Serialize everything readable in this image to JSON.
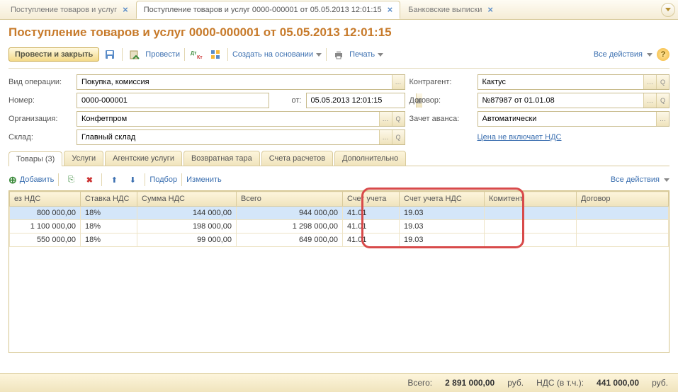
{
  "top_tabs": {
    "tab1": "Поступление товаров и услуг",
    "tab2": "Поступление товаров и услуг 0000-000001 от 05.05.2013 12:01:15",
    "tab3": "Банковские выписки"
  },
  "page_title": "Поступление товаров и услуг 0000-000001 от 05.05.2013 12:01:15",
  "toolbar": {
    "post_close": "Провести и закрыть",
    "post": "Провести",
    "create_based": "Создать на основании",
    "print": "Печать",
    "all_actions": "Все действия"
  },
  "form": {
    "op_type_label": "Вид операции:",
    "op_type_value": "Покупка, комиссия",
    "number_label": "Номер:",
    "number_value": "0000-000001",
    "from_label": "от:",
    "date_value": "05.05.2013 12:01:15",
    "org_label": "Организация:",
    "org_value": "Конфетпром",
    "warehouse_label": "Склад:",
    "warehouse_value": "Главный склад",
    "counterparty_label": "Контрагент:",
    "counterparty_value": "Кактус",
    "contract_label": "Договор:",
    "contract_value": "№87987 от 01.01.08",
    "advance_label": "Зачет аванса:",
    "advance_value": "Автоматически",
    "vat_link": "Цена не включает НДС"
  },
  "sub_tabs": {
    "t1": "Товары (3)",
    "t2": "Услуги",
    "t3": "Агентские услуги",
    "t4": "Возвратная тара",
    "t5": "Счета расчетов",
    "t6": "Дополнительно"
  },
  "grid_toolbar": {
    "add": "Добавить",
    "select": "Подбор",
    "edit": "Изменить",
    "all_actions": "Все действия"
  },
  "columns": {
    "c1": "ез НДС",
    "c2": "Ставка НДС",
    "c3": "Сумма НДС",
    "c4": "Всего",
    "c5": "Счет учета",
    "c6": "Счет учета НДС",
    "c7": "Комитент",
    "c8": "Договор"
  },
  "rows": [
    {
      "sum_ex": "800 000,00",
      "rate": "18%",
      "vat": "144 000,00",
      "total": "944 000,00",
      "acc": "41.01",
      "acc_vat": "19.03"
    },
    {
      "sum_ex": "1 100 000,00",
      "rate": "18%",
      "vat": "198 000,00",
      "total": "1 298 000,00",
      "acc": "41.01",
      "acc_vat": "19.03"
    },
    {
      "sum_ex": "550 000,00",
      "rate": "18%",
      "vat": "99 000,00",
      "total": "649 000,00",
      "acc": "41.01",
      "acc_vat": "19.03"
    }
  ],
  "footer": {
    "total_label": "Всего:",
    "total_value": "2 891 000,00",
    "rub": "руб.",
    "vat_label": "НДС (в т.ч.):",
    "vat_value": "441 000,00"
  }
}
